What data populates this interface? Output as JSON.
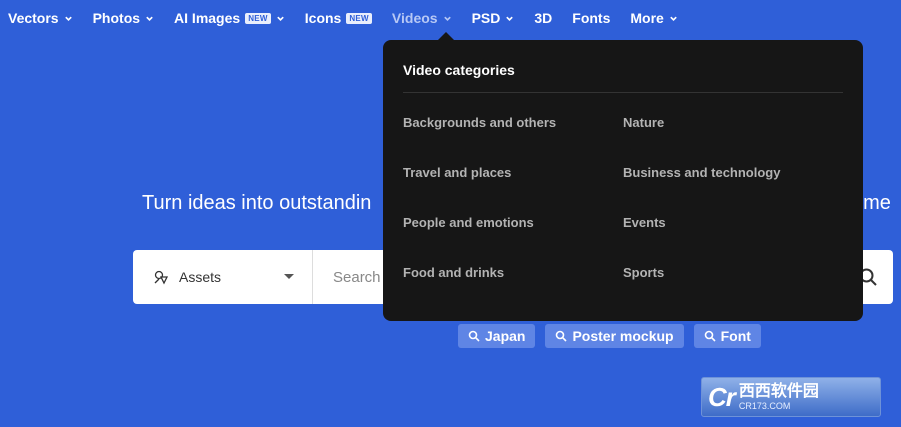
{
  "nav": {
    "items": [
      {
        "label": "Vectors",
        "badge": ""
      },
      {
        "label": "Photos",
        "badge": ""
      },
      {
        "label": "AI Images",
        "badge": "NEW"
      },
      {
        "label": "Icons",
        "badge": "NEW"
      },
      {
        "label": "Videos",
        "badge": ""
      },
      {
        "label": "PSD",
        "badge": ""
      },
      {
        "label": "3D",
        "badge": ""
      },
      {
        "label": "Fonts",
        "badge": ""
      },
      {
        "label": "More",
        "badge": ""
      }
    ],
    "active": "Videos"
  },
  "hero": {
    "title_left": "Turn ideas into outstandin",
    "title_right": "s, me"
  },
  "search": {
    "asset_select": "Assets",
    "placeholder": "Search"
  },
  "tags": [
    "Japan",
    "Poster mockup",
    "Font"
  ],
  "dropdown": {
    "title": "Video categories",
    "left_column": [
      "Backgrounds and others",
      "Travel and places",
      "People and emotions",
      "Food and drinks"
    ],
    "right_column": [
      "Nature",
      "Business and technology",
      "Events",
      "Sports"
    ]
  },
  "watermark": {
    "logo": "Cr",
    "brand": "西西软件园",
    "url": "CR173.COM"
  },
  "colors": {
    "background": "#2f5fd8",
    "dropdown_bg": "#161616",
    "tag_bg": "#5f85e5"
  }
}
